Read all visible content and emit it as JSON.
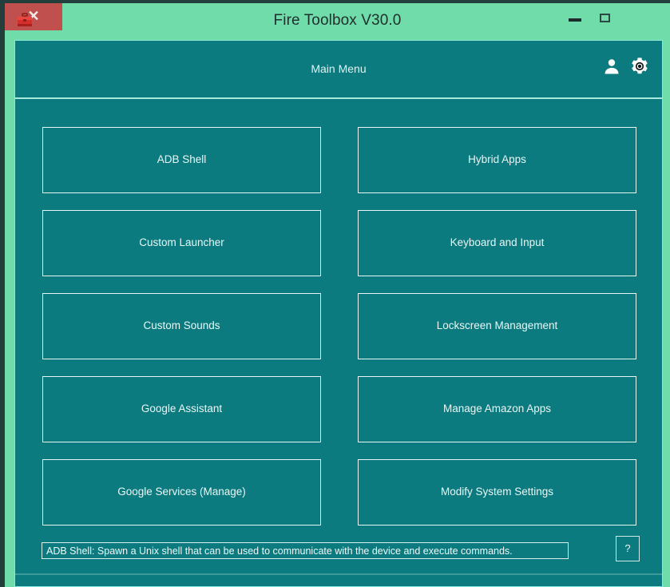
{
  "window": {
    "title": "Fire Toolbox V30.0",
    "app_icon": "toolbox-icon",
    "controls": {
      "minimize": "–",
      "maximize": "□",
      "close": "✕"
    },
    "colors": {
      "frame": "#6fdcaa",
      "client": "#0b7b80",
      "close_button": "#c0504d",
      "border_light": "#e7f6f2",
      "text": "#e9f7f5"
    }
  },
  "header": {
    "title": "Main Menu",
    "icons": [
      {
        "name": "user-icon",
        "label": "User"
      },
      {
        "name": "gear-icon",
        "label": "Settings"
      }
    ]
  },
  "main": {
    "buttons": [
      {
        "label": "ADB Shell"
      },
      {
        "label": "Hybrid Apps"
      },
      {
        "label": "Custom Launcher"
      },
      {
        "label": "Keyboard and Input"
      },
      {
        "label": "Custom Sounds"
      },
      {
        "label": "Lockscreen Management"
      },
      {
        "label": "Google Assistant"
      },
      {
        "label": "Manage Amazon Apps"
      },
      {
        "label": "Google Services (Manage)"
      },
      {
        "label": "Modify System Settings"
      }
    ]
  },
  "status": {
    "text": "ADB Shell: Spawn a Unix shell that can be used to communicate with the device and execute commands.",
    "help_label": "?"
  }
}
